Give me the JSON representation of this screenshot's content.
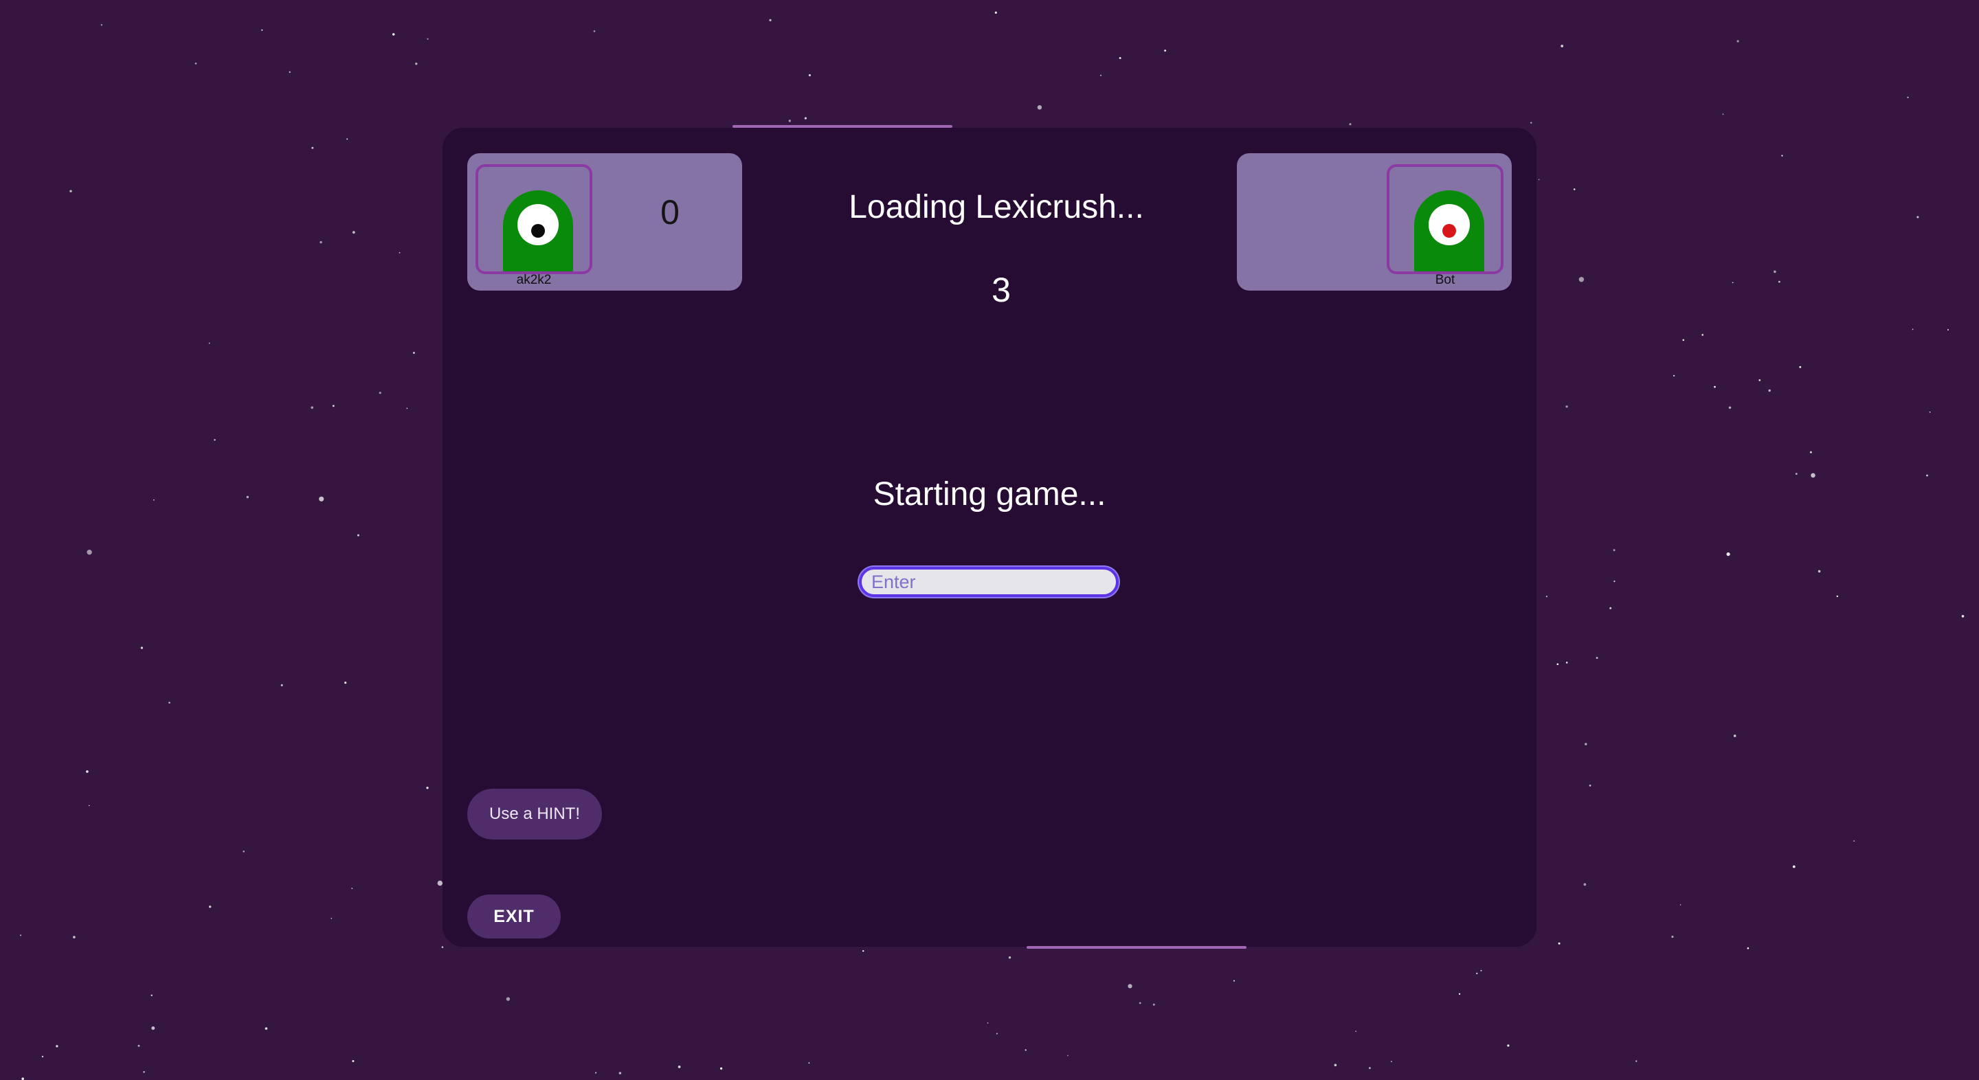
{
  "game": {
    "loading_title": "Loading Lexicrush...",
    "countdown": "3",
    "status": "Starting game..."
  },
  "players": {
    "left": {
      "name": "ak2k2",
      "score": "0",
      "pupil_color": "#0b0b0b"
    },
    "right": {
      "name": "Bot",
      "pupil_color": "#d8161a"
    }
  },
  "input": {
    "placeholder": "Enter",
    "value": ""
  },
  "buttons": {
    "hint": "Use a HINT!",
    "exit": "EXIT"
  },
  "colors": {
    "background": "#341641",
    "panel": "#260b33",
    "card": "#8573a6",
    "alien_body": "#0a8a0a",
    "avatar_border": "#8b3aa4",
    "button": "#4f2c6a",
    "input_border": "#5d33e6"
  },
  "icons": {
    "left_avatar": "green-cyclops-alien-icon",
    "right_avatar": "green-cyclops-alien-red-eye-icon"
  }
}
